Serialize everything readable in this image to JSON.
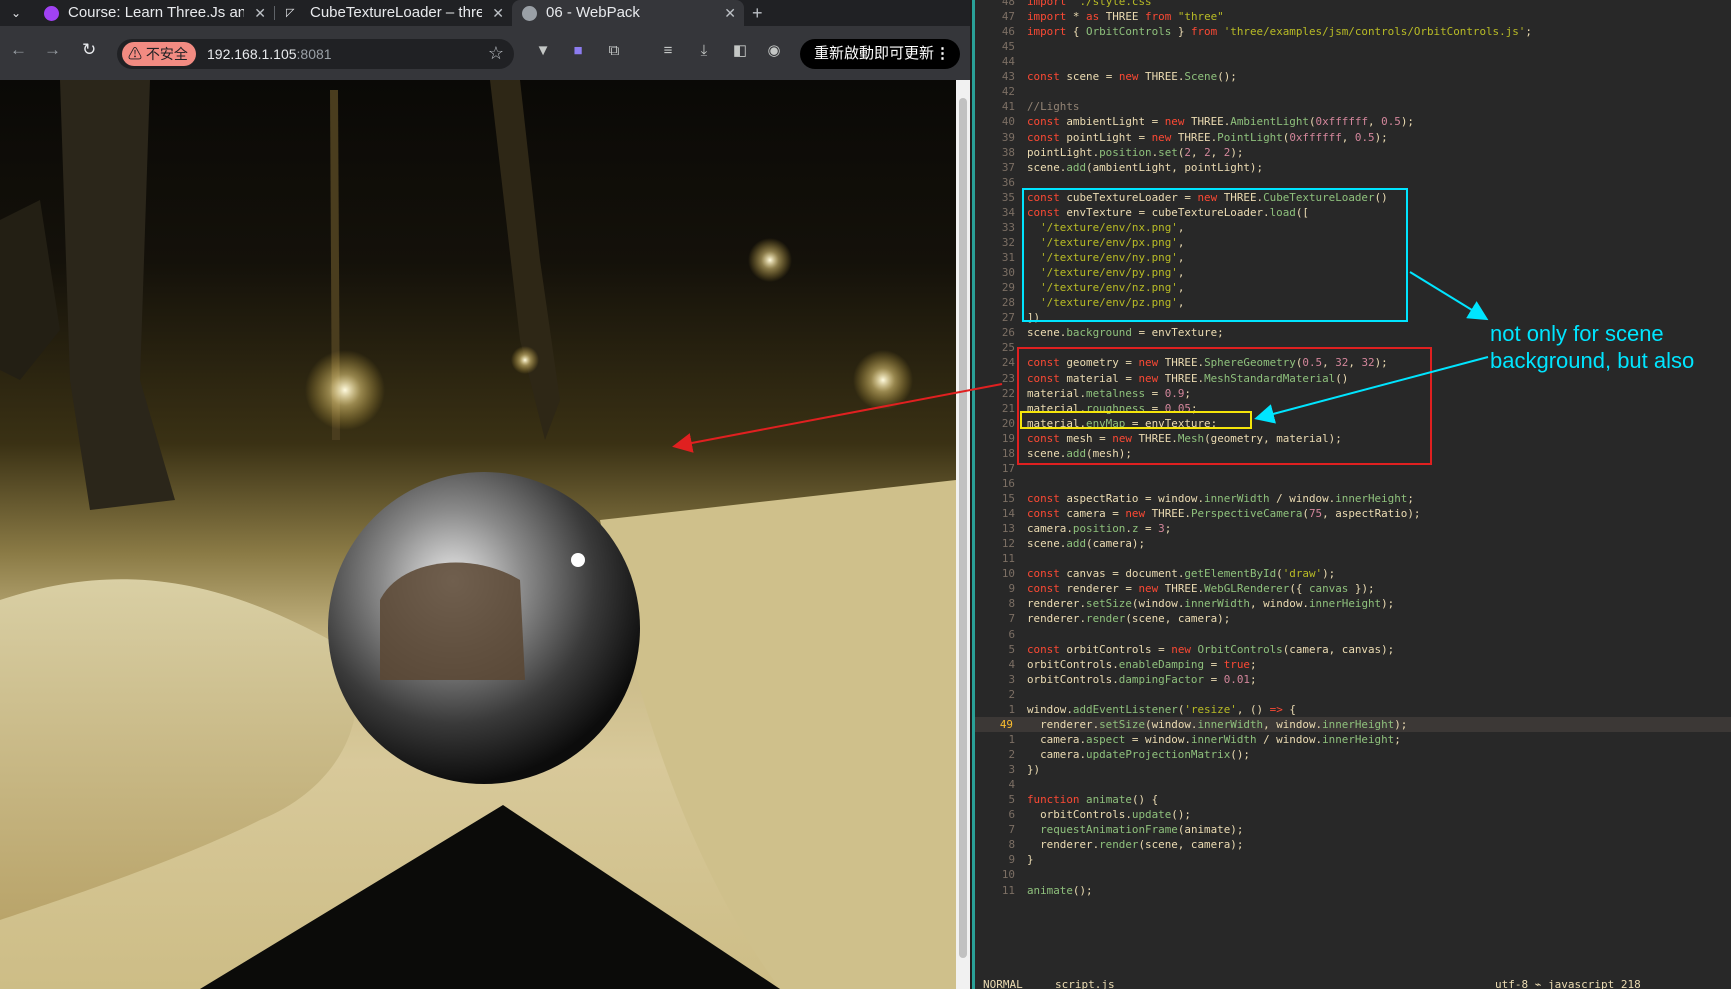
{
  "browser": {
    "tabs": [
      {
        "title": "Course: Learn Three.Js and",
        "icon": "course-favicon",
        "color": "#a142f4"
      },
      {
        "title": "CubeTextureLoader – three.js",
        "icon": "threejs-favicon",
        "color": "#e8eaed"
      },
      {
        "title": "06 - WebPack",
        "icon": "globe-icon",
        "color": "#9aa0a6"
      }
    ],
    "new_tab": "+",
    "security_chip": "不安全",
    "url_host": "192.168.1.105",
    "url_port": ":8081",
    "relaunch_label": "重新啟動即可更新",
    "menu_dots": "⋮"
  },
  "annotation": {
    "note_line1": "not only for scene",
    "note_line2": "background, but also",
    "colors": {
      "cyan": "#00e5ff",
      "red": "#e02020",
      "yellow": "#f5e50a"
    }
  },
  "editor": {
    "status_mode": "NORMAL",
    "status_file": "script.js",
    "status_right": "utf-8 ⌁ javascript  218",
    "lines": [
      {
        "ln": "48",
        "html": "<span class='k'>import</span> <span class='s'>'./style.css'</span>"
      },
      {
        "ln": "47",
        "html": "<span class='k'>import</span> * <span class='k'>as</span> THREE <span class='k'>from</span> <span class='s'>\"three\"</span>"
      },
      {
        "ln": "46",
        "html": "<span class='k'>import</span> { <span class='f'>OrbitControls</span> } <span class='k'>from</span> <span class='s'>'three/examples/jsm/controls/OrbitControls.js'</span>;"
      },
      {
        "ln": "45",
        "html": ""
      },
      {
        "ln": "44",
        "html": ""
      },
      {
        "ln": "43",
        "html": "<span class='k'>const</span> scene = <span class='k'>new</span> THREE.<span class='f'>Scene</span>();"
      },
      {
        "ln": "42",
        "html": ""
      },
      {
        "ln": "41",
        "html": "<span class='c'>//Lights</span>"
      },
      {
        "ln": "40",
        "html": "<span class='k'>const</span> ambientLight = <span class='k'>new</span> THREE.<span class='f'>AmbientLight</span>(<span class='n'>0xffffff</span>, <span class='n'>0.5</span>);"
      },
      {
        "ln": "39",
        "html": "<span class='k'>const</span> pointLight = <span class='k'>new</span> THREE.<span class='f'>PointLight</span>(<span class='n'>0xffffff</span>, <span class='n'>0.5</span>);"
      },
      {
        "ln": "38",
        "html": "pointLight.<span class='f'>position</span>.<span class='f'>set</span>(<span class='n'>2</span>, <span class='n'>2</span>, <span class='n'>2</span>);"
      },
      {
        "ln": "37",
        "html": "scene.<span class='f'>add</span>(ambientLight, pointLight);"
      },
      {
        "ln": "36",
        "html": ""
      },
      {
        "ln": "35",
        "html": "<span class='k'>const</span> cubeTextureLoader = <span class='k'>new</span> THREE.<span class='f'>CubeTextureLoader</span>()"
      },
      {
        "ln": "34",
        "html": "<span class='k'>const</span> envTexture = cubeTextureLoader.<span class='f'>load</span>(["
      },
      {
        "ln": "33",
        "html": "  <span class='s'>'/texture/env/nx.png'</span>,"
      },
      {
        "ln": "32",
        "html": "  <span class='s'>'/texture/env/px.png'</span>,"
      },
      {
        "ln": "31",
        "html": "  <span class='s'>'/texture/env/ny.png'</span>,"
      },
      {
        "ln": "30",
        "html": "  <span class='s'>'/texture/env/py.png'</span>,"
      },
      {
        "ln": "29",
        "html": "  <span class='s'>'/texture/env/nz.png'</span>,"
      },
      {
        "ln": "28",
        "html": "  <span class='s'>'/texture/env/pz.png'</span>,"
      },
      {
        "ln": "27",
        "html": "])"
      },
      {
        "ln": "26",
        "html": "scene.<span class='f'>background</span> = envTexture;"
      },
      {
        "ln": "25",
        "html": ""
      },
      {
        "ln": "24",
        "html": "<span class='k'>const</span> geometry = <span class='k'>new</span> THREE.<span class='f'>SphereGeometry</span>(<span class='n'>0.5</span>, <span class='n'>32</span>, <span class='n'>32</span>);"
      },
      {
        "ln": "23",
        "html": "<span class='k'>const</span> material = <span class='k'>new</span> THREE.<span class='f'>MeshStandardMaterial</span>()"
      },
      {
        "ln": "22",
        "html": "material.<span class='f'>metalness</span> = <span class='n'>0.9</span>;"
      },
      {
        "ln": "21",
        "html": "material.<span class='f'>roughness</span> = <span class='n'>0.05</span>;"
      },
      {
        "ln": "20",
        "html": "material.<span class='f'>envMap</span> = envTexture;"
      },
      {
        "ln": "19",
        "html": "<span class='k'>const</span> mesh = <span class='k'>new</span> THREE.<span class='f'>Mesh</span>(geometry, material);"
      },
      {
        "ln": "18",
        "html": "scene.<span class='f'>add</span>(mesh);"
      },
      {
        "ln": "17",
        "html": ""
      },
      {
        "ln": "16",
        "html": ""
      },
      {
        "ln": "15",
        "html": "<span class='k'>const</span> aspectRatio = window.<span class='f'>innerWidth</span> / window.<span class='f'>innerHeight</span>;"
      },
      {
        "ln": "14",
        "html": "<span class='k'>const</span> camera = <span class='k'>new</span> THREE.<span class='f'>PerspectiveCamera</span>(<span class='n'>75</span>, aspectRatio);"
      },
      {
        "ln": "13",
        "html": "camera.<span class='f'>position</span>.<span class='f'>z</span> = <span class='n'>3</span>;"
      },
      {
        "ln": "12",
        "html": "scene.<span class='f'>add</span>(camera);"
      },
      {
        "ln": "11",
        "html": ""
      },
      {
        "ln": "10",
        "html": "<span class='k'>const</span> canvas = document.<span class='f'>getElementById</span>(<span class='s'>'draw'</span>);"
      },
      {
        "ln": "9",
        "html": "<span class='k'>const</span> renderer = <span class='k'>new</span> THREE.<span class='f'>WebGLRenderer</span>({ <span class='f'>canvas</span> });"
      },
      {
        "ln": "8",
        "html": "renderer.<span class='f'>setSize</span>(window.<span class='f'>innerWidth</span>, window.<span class='f'>innerHeight</span>);"
      },
      {
        "ln": "7",
        "html": "renderer.<span class='f'>render</span>(scene, camera);"
      },
      {
        "ln": "6",
        "html": ""
      },
      {
        "ln": "5",
        "html": "<span class='k'>const</span> orbitControls = <span class='k'>new</span> <span class='f'>OrbitControls</span>(camera, canvas);"
      },
      {
        "ln": "4",
        "html": "orbitControls.<span class='f'>enableDamping</span> = <span class='k'>true</span>;"
      },
      {
        "ln": "3",
        "html": "orbitControls.<span class='f'>dampingFactor</span> = <span class='n'>0.01</span>;"
      },
      {
        "ln": "2",
        "html": ""
      },
      {
        "ln": "1",
        "html": "window.<span class='f'>addEventListener</span>(<span class='s'>'resize'</span>, () <span class='k'>=&gt;</span> {"
      },
      {
        "ln": "49",
        "html": "  renderer.<span class='f'>setSize</span>(window.<span class='f'>innerWidth</span>, window.<span class='f'>innerHeight</span>);",
        "cursor": true
      },
      {
        "ln": "1",
        "html": "  camera.<span class='f'>aspect</span> = window.<span class='f'>innerWidth</span> / window.<span class='f'>innerHeight</span>;"
      },
      {
        "ln": "2",
        "html": "  camera.<span class='f'>updateProjectionMatrix</span>();"
      },
      {
        "ln": "3",
        "html": "})"
      },
      {
        "ln": "4",
        "html": ""
      },
      {
        "ln": "5",
        "html": "<span class='k'>function</span> <span class='f'>animate</span>() {"
      },
      {
        "ln": "6",
        "html": "  orbitControls.<span class='f'>update</span>();"
      },
      {
        "ln": "7",
        "html": "  <span class='f'>requestAnimationFrame</span>(animate);"
      },
      {
        "ln": "8",
        "html": "  renderer.<span class='f'>render</span>(scene, camera);"
      },
      {
        "ln": "9",
        "html": "}"
      },
      {
        "ln": "10",
        "html": ""
      },
      {
        "ln": "11",
        "html": "<span class='f'>animate</span>();"
      }
    ]
  }
}
